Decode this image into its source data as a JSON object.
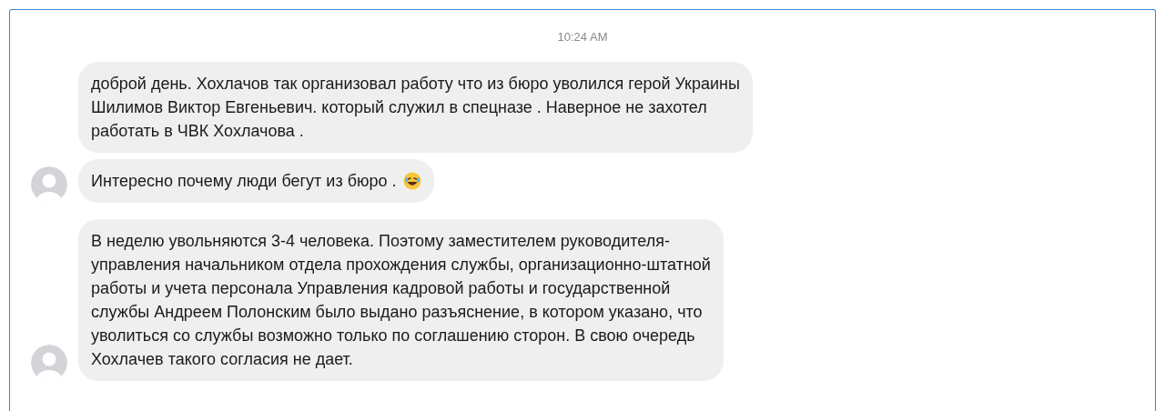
{
  "timestamp": "10:24 AM",
  "groups": [
    {
      "messages": [
        {
          "lines": [
            "доброй день. Хохлачов так организовал работу что из бюро уволился герой Украины",
            "Шилимов Виктор Евгеньевич. который служил в спецназе . Наверное не захотел",
            "работать в ЧВК Хохлачова ."
          ],
          "emoji": false
        },
        {
          "lines": [
            "Интересно почему люди бегут из бюро ."
          ],
          "emoji": true
        }
      ]
    },
    {
      "messages": [
        {
          "lines": [
            "В неделю увольняются 3-4 человека. Поэтому заместителем руководителя-",
            "управления начальником отдела прохождения службы, организационно-штатной",
            "работы и учета персонала Управления кадровой работы и государственной",
            "службы Андреем Полонским было выдано разъяснение, в котором указано, что",
            "уволиться со службы возможно только по соглашению сторон. В свою очередь",
            "Хохлачев такого согласия не дает."
          ],
          "emoji": false
        }
      ]
    }
  ]
}
